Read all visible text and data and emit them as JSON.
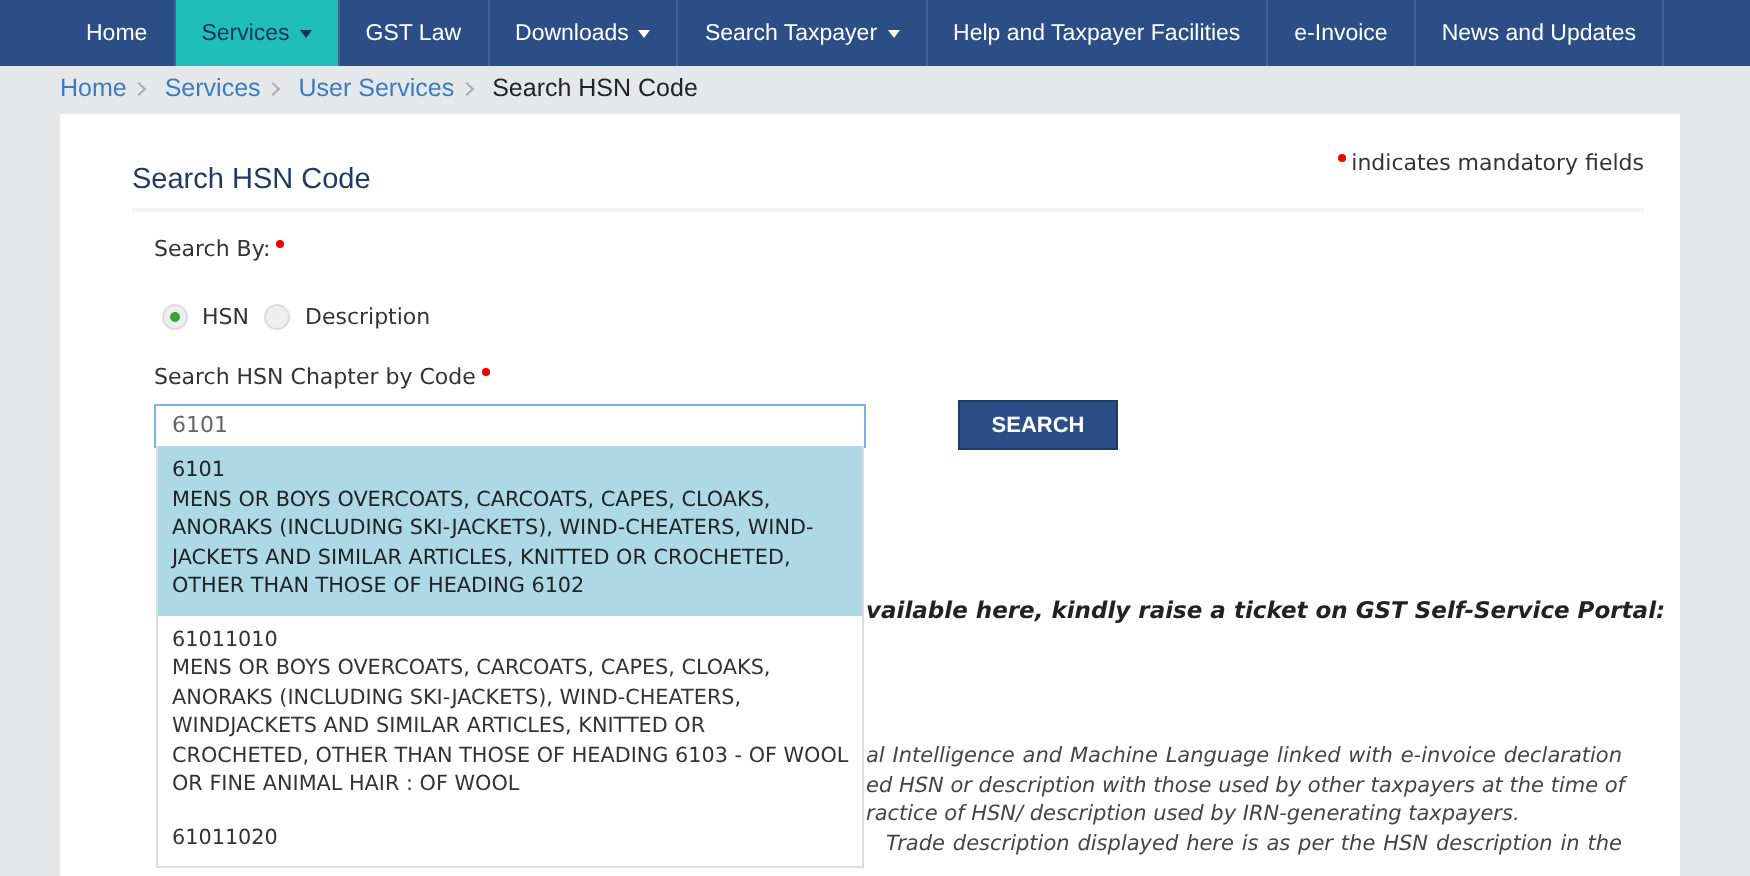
{
  "nav": [
    {
      "label": "Home",
      "selected": false,
      "dropdown": false
    },
    {
      "label": "Services",
      "selected": true,
      "dropdown": true
    },
    {
      "label": "GST Law",
      "selected": false,
      "dropdown": false
    },
    {
      "label": "Downloads",
      "selected": false,
      "dropdown": true
    },
    {
      "label": "Search Taxpayer",
      "selected": false,
      "dropdown": true
    },
    {
      "label": "Help and Taxpayer Facilities",
      "selected": false,
      "dropdown": false
    },
    {
      "label": "e-Invoice",
      "selected": false,
      "dropdown": false
    },
    {
      "label": "News and Updates",
      "selected": false,
      "dropdown": false
    }
  ],
  "breadcrumb": {
    "links": [
      "Home",
      "Services",
      "User Services"
    ],
    "current": "Search HSN Code"
  },
  "page_title": "Search HSN Code",
  "mandatory_note": "indicates mandatory fields",
  "search_by": {
    "label": "Search By:",
    "options": [
      {
        "label": "HSN",
        "selected": true
      },
      {
        "label": "Description",
        "selected": false
      }
    ]
  },
  "code_field": {
    "label": "Search HSN Chapter by Code",
    "value": "6101"
  },
  "search_button": "SEARCH",
  "suggestions": [
    {
      "code": "6101",
      "selected": true,
      "lines": [
        "MENS OR BOYS OVERCOATS, CARCOATS, CAPES, CLOAKS,",
        "ANORAKS (INCLUDING SKI-JACKETS), WIND-CHEATERS, WIND-",
        "JACKETS AND SIMILAR ARTICLES, KNITTED OR CROCHETED,",
        "OTHER THAN THOSE OF HEADING 6102"
      ]
    },
    {
      "code": "61011010",
      "selected": false,
      "lines": [
        "MENS OR BOYS OVERCOATS, CARCOATS, CAPES, CLOAKS,",
        "ANORAKS (INCLUDING SKI-JACKETS), WIND-CHEATERS,",
        "WINDJACKETS AND SIMILAR ARTICLES, KNITTED OR",
        "CROCHETED, OTHER THAN THOSE OF HEADING 6103 - OF WOOL",
        "OR FINE ANIMAL HAIR : OF WOOL"
      ]
    },
    {
      "code": "61011020",
      "selected": false
    }
  ],
  "notice": "vailable here, kindly raise a ticket on GST Self-Service Portal:",
  "disclaimer_lines": [
    "al Intelligence and Machine Language linked with e-invoice declaration",
    "ed HSN or description with those used by other taxpayers at the time of",
    "ractice of HSN/ description used by IRN-generating taxpayers.",
    "Trade description displayed here is as per the HSN description in the"
  ]
}
